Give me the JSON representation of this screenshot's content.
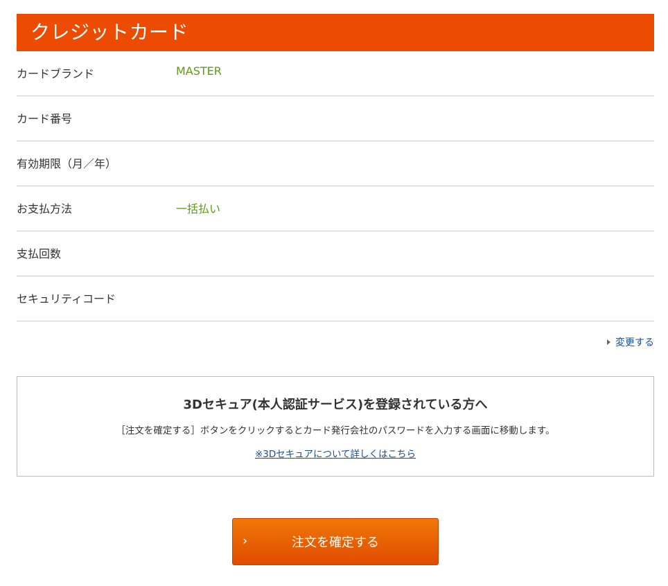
{
  "section": {
    "title": "クレジットカード"
  },
  "rows": [
    {
      "label": "カードブランド",
      "value": "MASTER"
    },
    {
      "label": "カード番号",
      "value": ""
    },
    {
      "label": "有効期限（月／年）",
      "value": ""
    },
    {
      "label": "お支払方法",
      "value": "一括払い"
    },
    {
      "label": "支払回数",
      "value": ""
    },
    {
      "label": "セキュリティコード",
      "value": ""
    }
  ],
  "change_link": {
    "label": "変更する",
    "icon": "triangle-right-icon"
  },
  "secure_box": {
    "title": "3Dセキュア(本人認証サービス)を登録されている方へ",
    "description": "［注文を確定する］ボタンをクリックするとカード発行会社のパスワードを入力する画面に移動します。",
    "link_label": "※3Dセキュアについて詳しくはこちら"
  },
  "confirm_button": {
    "label": "注文を確定する",
    "icon": "chevron-right-icon"
  },
  "colors": {
    "header_bg": "#ec4b02",
    "value_text": "#5c9a14",
    "link": "#1a4d8f",
    "button_top": "#f07806",
    "button_bottom": "#e04b02"
  }
}
